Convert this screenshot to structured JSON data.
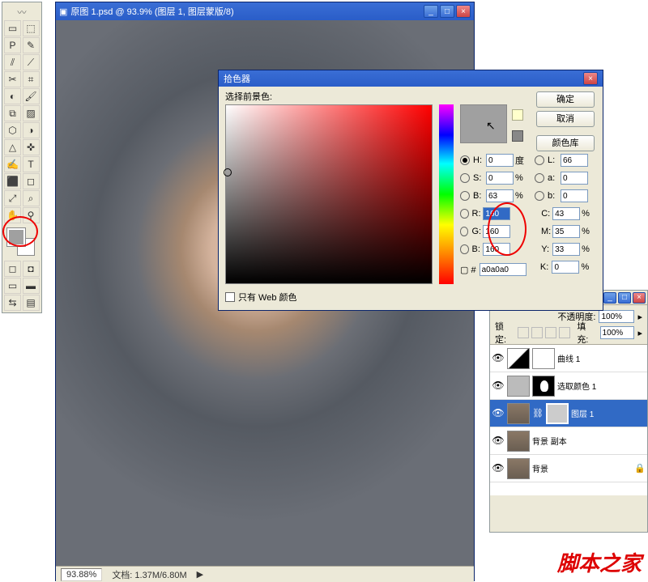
{
  "toolbox": {
    "tools": [
      "▭",
      "⬚",
      "P",
      "✎",
      "⫽",
      "⟋",
      "✂",
      "⌗",
      "◐",
      "🖌",
      "⧉",
      "▨",
      "⬡",
      "◑",
      "△",
      "✜",
      "✍",
      "T",
      "⬛",
      "◻",
      "⤢",
      "⌕",
      "✋",
      "⚲"
    ]
  },
  "doc": {
    "title": "原图 1.psd @ 93.9% (图层 1, 图层蒙版/8)",
    "zoom": "93.88%",
    "filesize": "文档: 1.37M/6.80M"
  },
  "picker": {
    "title": "拾色器",
    "label": "选择前景色:",
    "ok": "确定",
    "cancel": "取消",
    "lib": "颜色库",
    "H": "0",
    "Hdeg": "度",
    "S": "0",
    "B": "63",
    "L": "66",
    "a": "0",
    "b": "0",
    "R": "160",
    "G": "160",
    "Bv": "160",
    "C": "43",
    "M": "35",
    "Y": "33",
    "K": "0",
    "hex": "a0a0a0",
    "webonly": "只有 Web 颜色"
  },
  "layers": {
    "opacity_lbl": "不透明度:",
    "opacity": "100%",
    "fill_lbl": "填充:",
    "fill": "100%",
    "lock_lbl": "锁定:",
    "items": [
      {
        "name": "曲线 1"
      },
      {
        "name": "选取颜色 1"
      },
      {
        "name": "图层 1"
      },
      {
        "name": "背景 副本"
      },
      {
        "name": "背景"
      }
    ]
  },
  "watermark": "脚本之家"
}
